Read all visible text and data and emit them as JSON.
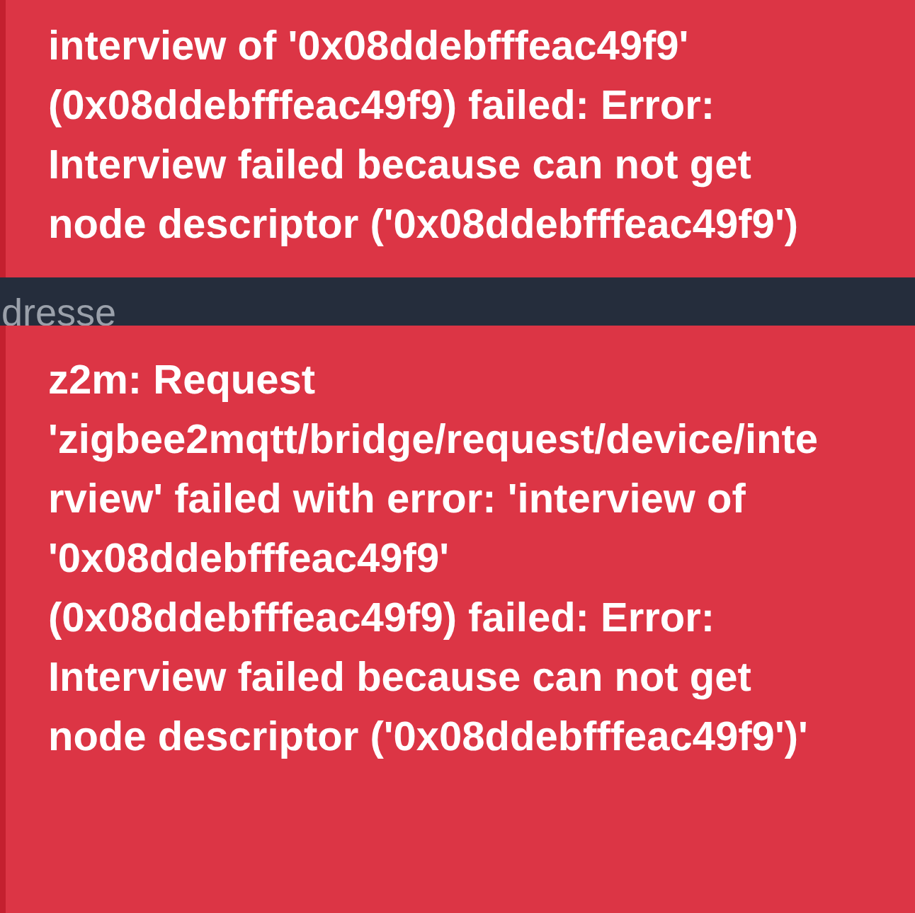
{
  "notifications": [
    {
      "message": "interview of '0x08ddebfffeac49f9' (0x08ddebfffeac49f9) failed: Error: Interview failed because can not get node descriptor ('0x08ddebfffeac49f9')"
    },
    {
      "message": "z2m: Request 'zigbee2mqtt/bridge/request/device/interview' failed with error: 'interview of '0x08ddebfffeac49f9' (0x08ddebfffeac49f9) failed: Error: Interview failed because can not get node descriptor ('0x08ddebfffeac49f9')'"
    }
  ],
  "background_label": "dresse"
}
